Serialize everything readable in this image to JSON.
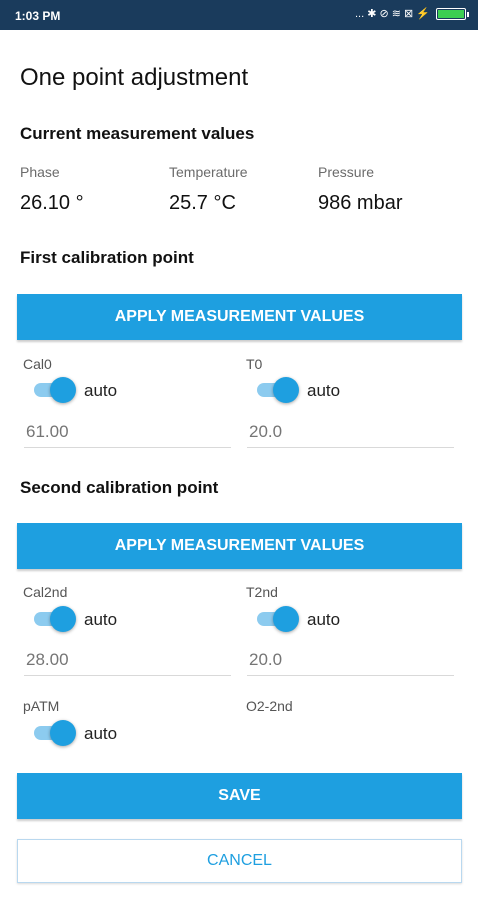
{
  "status_bar": {
    "time": "1:03 PM",
    "icons": "... ✱ ⊘ ≋ ⊠ ⚡"
  },
  "title": "One point adjustment",
  "current": {
    "heading": "Current measurement values",
    "phase_label": "Phase",
    "phase_value": "26.10 °",
    "temp_label": "Temperature",
    "temp_value": "25.7 °C",
    "pressure_label": "Pressure",
    "pressure_value": "986 mbar"
  },
  "first": {
    "heading": "First calibration point",
    "apply_label": "APPLY MEASUREMENT VALUES",
    "cal0_label": "Cal0",
    "cal0_auto": "auto",
    "cal0_placeholder": "61.00",
    "t0_label": "T0",
    "t0_auto": "auto",
    "t0_placeholder": "20.0"
  },
  "second": {
    "heading": "Second calibration point",
    "apply_label": "APPLY MEASUREMENT VALUES",
    "cal2nd_label": "Cal2nd",
    "cal2nd_auto": "auto",
    "cal2nd_placeholder": "28.00",
    "t2nd_label": "T2nd",
    "t2nd_auto": "auto",
    "t2nd_placeholder": "20.0",
    "patm_label": "pATM",
    "patm_auto": "auto",
    "o2_label": "O2-2nd"
  },
  "toggles": {
    "cal0": true,
    "t0": true,
    "cal2nd": true,
    "t2nd": true,
    "patm": true
  },
  "actions": {
    "save_label": "SAVE",
    "cancel_label": "CANCEL"
  },
  "colors": {
    "accent": "#1e9fe0",
    "status_bar": "#1a3b5c",
    "battery": "#3ccf52"
  }
}
